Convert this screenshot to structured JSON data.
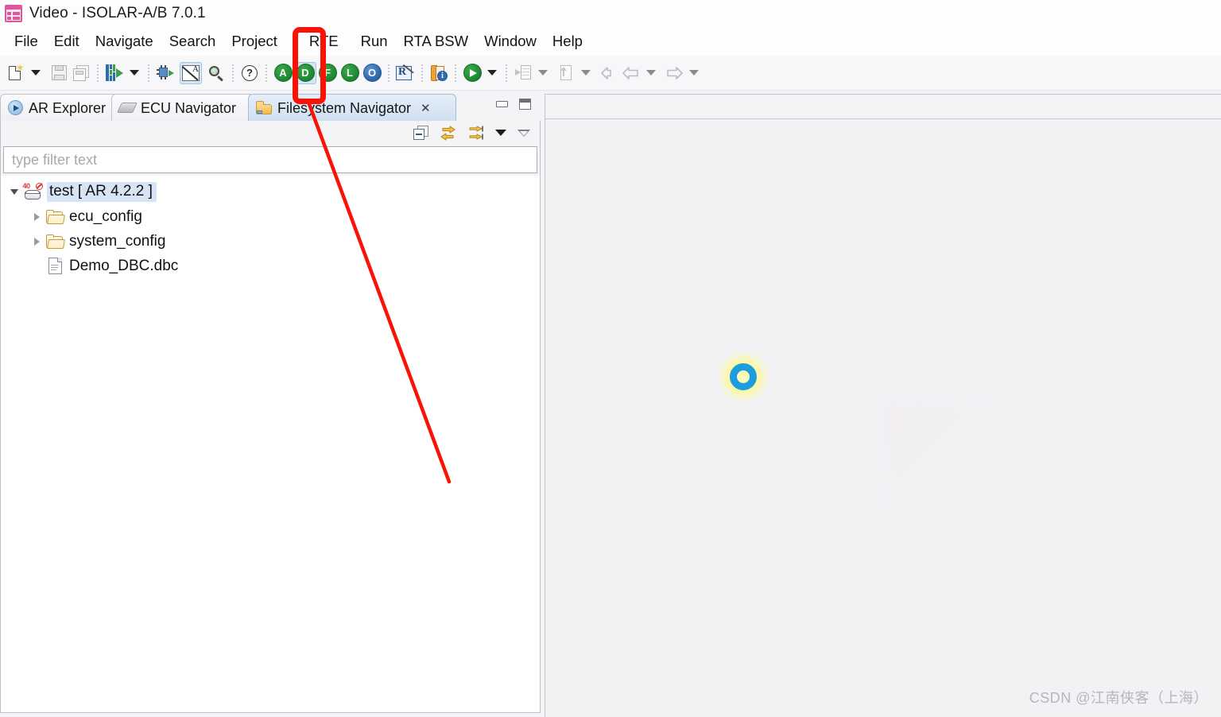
{
  "window": {
    "title": "Video - ISOLAR-A/B 7.0.1",
    "app_icon": "isolar-app-icon"
  },
  "menubar": {
    "items": [
      {
        "label": "File"
      },
      {
        "label": "Edit"
      },
      {
        "label": "Navigate"
      },
      {
        "label": "Search"
      },
      {
        "label": "Project"
      },
      {
        "label": "RTE"
      },
      {
        "label": "Run"
      },
      {
        "label": "RTA BSW"
      },
      {
        "label": "Window"
      },
      {
        "label": "Help"
      }
    ]
  },
  "toolbar": {
    "letter_buttons": [
      {
        "letter": "A",
        "color": "#1f8b33"
      },
      {
        "letter": "D",
        "color": "#1f8b33"
      },
      {
        "letter": "F",
        "color": "#1f8b33"
      },
      {
        "letter": "L",
        "color": "#1f8b33"
      },
      {
        "letter": "O",
        "color": "#2f6bab"
      }
    ],
    "book_badge": "i",
    "rpencil_letter": "R",
    "help_glyph": "?",
    "pen_letter": "A"
  },
  "left_view": {
    "tabs": [
      {
        "label": "AR Explorer",
        "icon": "ar-explorer-icon",
        "active": false,
        "closable": false
      },
      {
        "label": "ECU Navigator",
        "icon": "ecu-navigator-icon",
        "active": false,
        "closable": false
      },
      {
        "label": "Filesystem Navigator",
        "icon": "filesystem-navigator-icon",
        "active": true,
        "closable": true,
        "close_glyph": "✕"
      }
    ],
    "filter": {
      "placeholder": "type filter text",
      "value": ""
    },
    "tree": [
      {
        "label": "test [ AR 4.2.2 ]",
        "icon": "ar-project-icon",
        "depth": 0,
        "twisty": "down",
        "selected": true,
        "badge": "40"
      },
      {
        "label": "ecu_config",
        "icon": "folder-icon",
        "depth": 1,
        "twisty": "right",
        "selected": false
      },
      {
        "label": "system_config",
        "icon": "folder-icon",
        "depth": 1,
        "twisty": "right",
        "selected": false
      },
      {
        "label": "Demo_DBC.dbc",
        "icon": "file-icon",
        "depth": 1,
        "twisty": "none",
        "selected": false
      }
    ]
  },
  "editor": {
    "status": "loading",
    "spinner": "loading-spinner"
  },
  "watermark": {
    "text": "CSDN @江南侠客（上海）"
  },
  "annotation": {
    "color": "#fa1205",
    "highlight_target": "toolbar-button-d"
  }
}
